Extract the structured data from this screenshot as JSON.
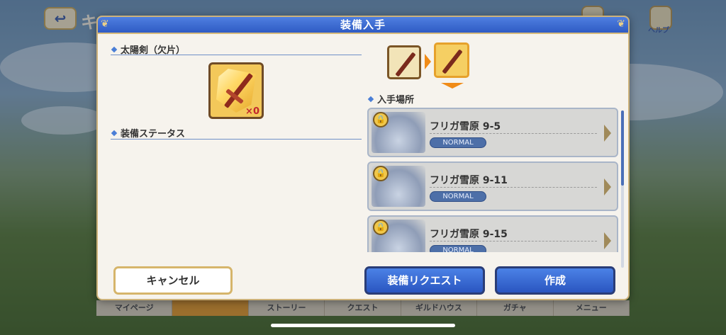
{
  "dialog": {
    "title": "装備入手"
  },
  "item": {
    "name": "太陽剣（欠片）",
    "count_label": "×0"
  },
  "status_section": {
    "title": "装備ステータス"
  },
  "acquisition": {
    "title": "入手場所",
    "stages": [
      {
        "name": "フリガ雪原 9-5",
        "difficulty": "NORMAL"
      },
      {
        "name": "フリガ雪原 9-11",
        "difficulty": "NORMAL"
      },
      {
        "name": "フリガ雪原 9-15",
        "difficulty": "NORMAL"
      }
    ]
  },
  "buttons": {
    "cancel": "キャンセル",
    "request": "装備リクエスト",
    "craft": "作成"
  },
  "background": {
    "back_label": "↩",
    "title_fragment": "キ",
    "help_label": "ヘルプ",
    "nav": [
      "マイページ",
      "",
      "ストーリー",
      "クエスト",
      "ギルドハウス",
      "ガチャ",
      "メニュー"
    ]
  },
  "colors": {
    "header_blue": "#2f5bc4",
    "accent_orange": "#f08b17",
    "badge_blue": "#4d6fa8"
  }
}
